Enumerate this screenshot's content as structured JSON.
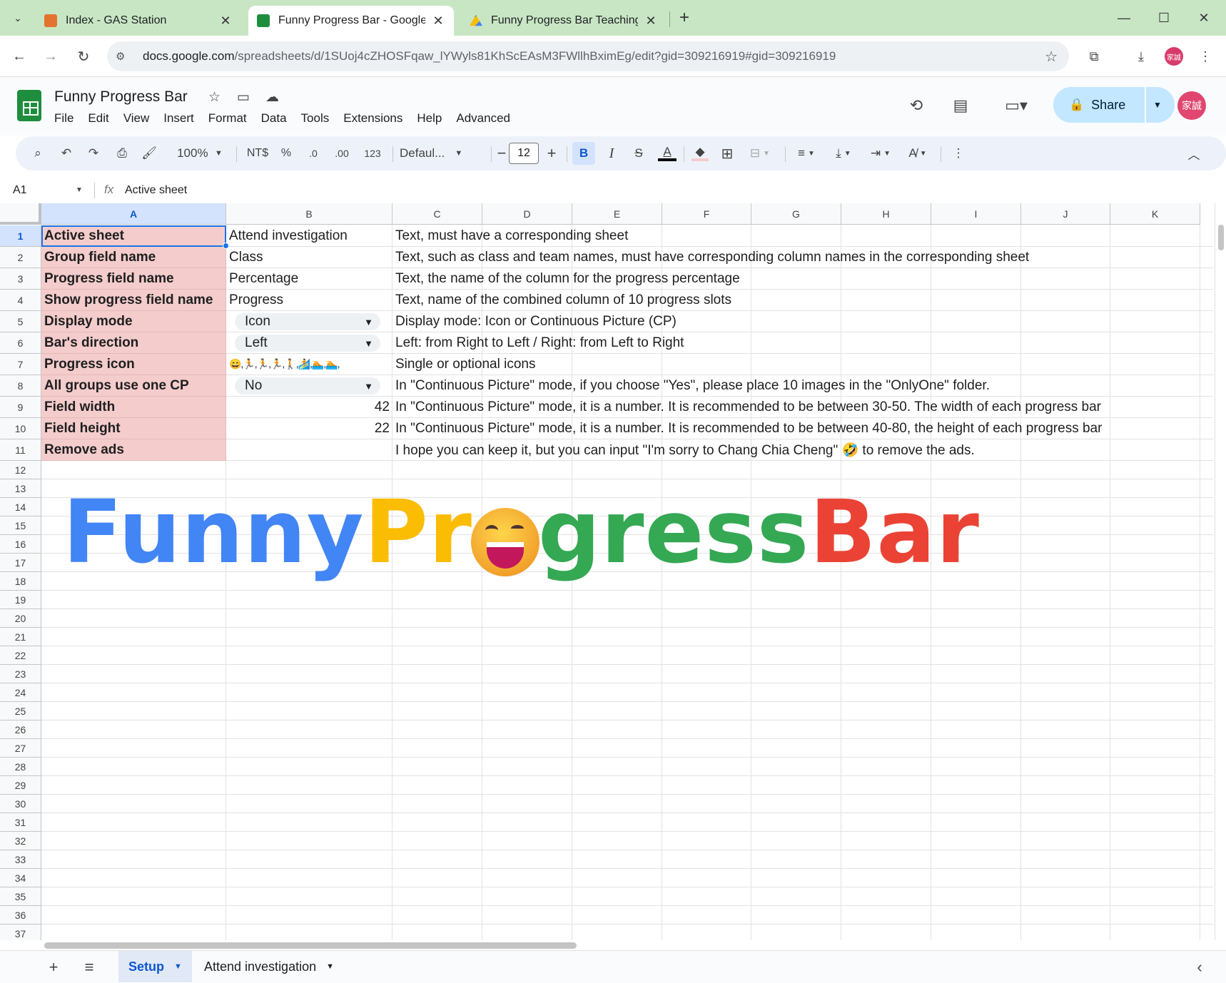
{
  "browser": {
    "tabs": [
      {
        "title": "Index - GAS Station",
        "active": false,
        "favicon_color": "#e3742f"
      },
      {
        "title": "Funny Progress Bar - Google S",
        "active": true,
        "favicon_color": "#1e8e3e"
      },
      {
        "title": "Funny Progress Bar Teaching",
        "active": false,
        "favicon_color": "#fbbc04"
      }
    ],
    "url_host": "docs.google.com",
    "url_path": "/spreadsheets/d/1SUoj4cZHOSFqaw_lYWyls81KhScEAsM3FWllhBximEg/edit?gid=309216919#gid=309216919",
    "profile_initials": "家誠"
  },
  "doc": {
    "title": "Funny Progress Bar",
    "menu": [
      "File",
      "Edit",
      "View",
      "Insert",
      "Format",
      "Data",
      "Tools",
      "Extensions",
      "Help",
      "Advanced"
    ],
    "share_label": "Share",
    "account_initials": "家誠"
  },
  "toolbar": {
    "zoom": "100%",
    "currency": "NT$",
    "percent": "%",
    "dec_decrease": ".0",
    "dec_increase": ".00",
    "number_format": "123",
    "font": "Defaul...",
    "font_size": "12",
    "bold": "B",
    "italic": "I",
    "text_color_letter": "A"
  },
  "formula_bar": {
    "name_box": "A1",
    "fx": "fx",
    "value": "Active sheet"
  },
  "grid": {
    "columns": [
      "A",
      "B",
      "C",
      "D",
      "E",
      "F",
      "G",
      "H",
      "I",
      "J",
      "K"
    ],
    "selected_column": "A",
    "selected_row": "1",
    "rows": [
      "1",
      "2",
      "3",
      "4",
      "5",
      "6",
      "7",
      "8",
      "9",
      "10",
      "11",
      "12",
      "13",
      "14",
      "15",
      "16",
      "17",
      "18",
      "19",
      "20",
      "21",
      "22",
      "23",
      "24",
      "25",
      "26",
      "27",
      "28",
      "29",
      "30",
      "31",
      "32",
      "33",
      "34",
      "35",
      "36",
      "37"
    ],
    "data": [
      {
        "a": "Active sheet",
        "b": "Attend investigation",
        "c": "Text, must have a corresponding sheet"
      },
      {
        "a": "Group field name",
        "b": "Class",
        "c": "Text, such as class and team names, must have corresponding column names in the corresponding sheet"
      },
      {
        "a": "Progress field name",
        "b": "Percentage",
        "c": "Text, the name of the column for the progress percentage"
      },
      {
        "a": "Show progress field name",
        "b": "Progress",
        "c": "Text, name of the combined column of 10 progress slots"
      },
      {
        "a": "Display mode",
        "b": "Icon",
        "c": "Display mode: Icon or Continuous Picture (CP)"
      },
      {
        "a": "Bar's direction",
        "b": "Left",
        "c": "Left: from Right to Left / Right: from Left to Right"
      },
      {
        "a": "Progress icon",
        "b": "😄,🏃,🏃,🏃,🚶,🏄,🏊,🏊,",
        "c": "Single or optional icons"
      },
      {
        "a": "All groups use one CP",
        "b": "No",
        "c": "In \"Continuous Picture\" mode, if you choose \"Yes\", please place 10 images in the \"OnlyOne\" folder."
      },
      {
        "a": "Field width",
        "b": "42",
        "c": "In \"Continuous Picture\" mode, it is a number. It is recommended to be between 30-50. The width of each progress bar"
      },
      {
        "a": "Field height",
        "b": "22",
        "c": "In \"Continuous Picture\" mode, it is a number. It is recommended to be between 40-80, the height of each progress bar"
      },
      {
        "a": "Remove ads",
        "b": "",
        "c": "I hope you can keep it, but you can input \"I'm sorry to Chang Chia Cheng\"  🤣  to remove the ads."
      }
    ]
  },
  "logo": {
    "part1": "Funny",
    "part1_color": "#4285f4",
    "part2": "Pr",
    "part2_color": "#fbbc04",
    "part3": "gress",
    "part3_color": "#34a853",
    "part4": "Bar",
    "part4_color": "#ea4335"
  },
  "sheets": {
    "tabs": [
      {
        "name": "Setup",
        "active": true
      },
      {
        "name": "Attend investigation",
        "active": false
      }
    ]
  }
}
